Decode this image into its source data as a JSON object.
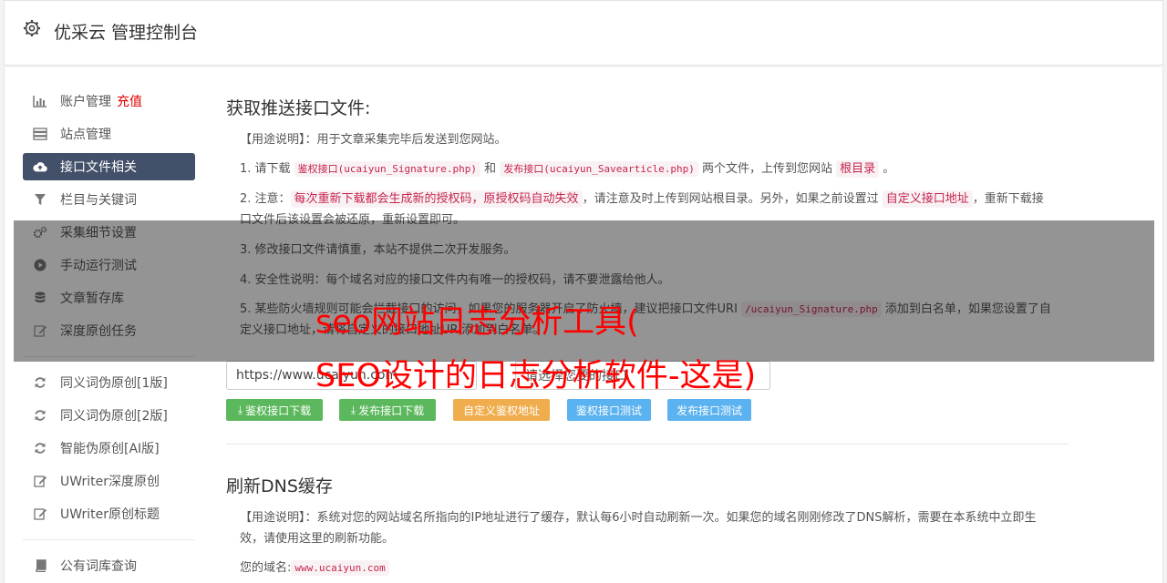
{
  "header": {
    "title": "优采云 管理控制台"
  },
  "sidebar": {
    "items": [
      {
        "label": "账户管理",
        "extra": "充值",
        "icon": "bar-chart-icon"
      },
      {
        "label": "站点管理",
        "icon": "server-icon"
      },
      {
        "label": "接口文件相关",
        "icon": "cloud-upload-icon",
        "active": true
      },
      {
        "label": "栏目与关键词",
        "icon": "filter-icon"
      },
      {
        "label": "采集细节设置",
        "icon": "gears-icon"
      },
      {
        "label": "手动运行测试",
        "icon": "play-circle-icon"
      },
      {
        "label": "文章暂存库",
        "icon": "database-icon"
      },
      {
        "label": "深度原创任务",
        "icon": "edit-icon"
      },
      {
        "label": "同义词伪原创[1版]",
        "icon": "refresh-icon"
      },
      {
        "label": "同义词伪原创[2版]",
        "icon": "refresh-icon"
      },
      {
        "label": "智能伪原创[AI版]",
        "icon": "refresh-icon"
      },
      {
        "label": "UWriter深度原创",
        "icon": "edit-icon"
      },
      {
        "label": "UWriter原创标题",
        "icon": "edit-icon"
      },
      {
        "label": "公有词库查询",
        "icon": "book-icon"
      }
    ]
  },
  "section1": {
    "title": "获取推送接口文件:",
    "usage_label": "【用途说明】",
    "usage_text": "：用于文章采集完毕后发送到您网站。",
    "item1": {
      "a": "1. 请下载 ",
      "c1": "鉴权接口(ucaiyun_Signature.php)",
      "b": " 和 ",
      "c2": "发布接口(ucaiyun_Savearticle.php)",
      "d": " 两个文件，上传到您网站 ",
      "c3": "根目录",
      "e": " 。"
    },
    "item2": {
      "a": "2. 注意：",
      "c1": "每次重新下载都会生成新的授权码，原授权码自动失效",
      "b": "，请注意及时上传到网站根目录。另外，如果之前设置过 ",
      "c2": "自定义接口地址",
      "c": "，重新下载接口文件后该设置会被还原，重新设置即可。"
    },
    "item3": "3. 修改接口文件请慎重，本站不提供二次开发服务。",
    "item4": "4. 安全性说明：每个域名对应的接口文件内有唯一的授权码，请不要泄露给他人。",
    "item5": {
      "a": "5. 某些防火墙规则可能会拦截接口的访问，如果您的服务器开启了防火墙，建议把接口文件URI ",
      "c1": "/ucaiyun_Signature.php",
      "b": " 添加到白名单，如果您设置了自定义接口地址，请将自定义的接口地址URI添加到白名单。"
    },
    "site_input_value": "https://www.ucaiyun.com",
    "select_placeholder": "请选择您要的接口",
    "buttons": {
      "sig_download": "鉴权接口下载",
      "pub_download": "发布接口下载",
      "custom_addr": "自定义鉴权地址",
      "sig_test": "鉴权接口测试",
      "pub_test": "发布接口测试"
    }
  },
  "section2": {
    "title": "刷新DNS缓存",
    "usage_label": "【用途说明】",
    "usage_text": "：系统对您的网站域名所指向的IP地址进行了缓存，默认每6小时自动刷新一次。如果您的域名刚刚修改了DNS解析，需要在本系统中立即生效，请使用这里的刷新功能。",
    "domain_label": "您的域名:",
    "domain_value": "www.ucaiyun.com"
  },
  "watermark": {
    "line1": "seo网站日志分析工具(",
    "line2": "SEO设计的日志分析软件-这是)"
  },
  "colors": {
    "active_nav": "#435069",
    "green": "#5cb85c",
    "orange": "#f0ad4e",
    "blue": "#5bb2f0",
    "highlight": "#c7254e",
    "watermark": "#ff0000"
  }
}
